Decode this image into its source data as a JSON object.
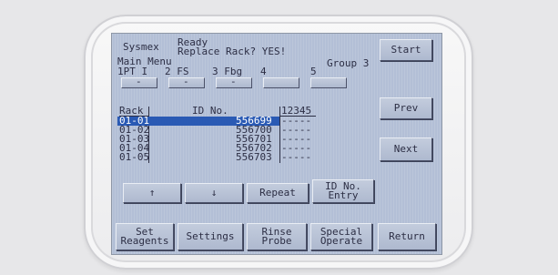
{
  "header": {
    "brand": "Sysmex",
    "status_line1": "Ready",
    "status_line2": "Replace Rack? YES!",
    "menu_title": "Main Menu",
    "group_label": "Group 3"
  },
  "start_button": "Start",
  "menu_tabs": [
    {
      "label": "1PT I",
      "marker": "-"
    },
    {
      "label": "2 FS",
      "marker": "-"
    },
    {
      "label": "3 Fbg",
      "marker": "-"
    },
    {
      "label": "4",
      "marker": ""
    },
    {
      "label": "5",
      "marker": ""
    }
  ],
  "table": {
    "headers": {
      "rack": "Rack",
      "id": "ID No.",
      "positions": "12345"
    },
    "rows": [
      {
        "rack": "01-01",
        "id": "556699",
        "positions": "-----",
        "selected": true
      },
      {
        "rack": "01-02",
        "id": "556700",
        "positions": "-----",
        "selected": false
      },
      {
        "rack": "01-03",
        "id": "556701",
        "positions": "-----",
        "selected": false
      },
      {
        "rack": "01-04",
        "id": "556702",
        "positions": "-----",
        "selected": false
      },
      {
        "rack": "01-05",
        "id": "556703",
        "positions": "-----",
        "selected": false
      }
    ]
  },
  "side_buttons": {
    "prev": "Prev",
    "next": "Next"
  },
  "action_buttons": {
    "up": "↑",
    "down": "↓",
    "repeat": "Repeat",
    "id_entry_1": "ID No.",
    "id_entry_2": "Entry"
  },
  "bottom_buttons": [
    {
      "line1": "Set",
      "line2": "Reagents"
    },
    {
      "line1": "Settings",
      "line2": ""
    },
    {
      "line1": "Rinse",
      "line2": "Probe"
    },
    {
      "line1": "Special",
      "line2": "Operate"
    },
    {
      "line1": "Return",
      "line2": ""
    }
  ],
  "colors": {
    "screen": "#b3bfd6",
    "selection": "#2a5ab4",
    "text": "#2c2e44"
  }
}
